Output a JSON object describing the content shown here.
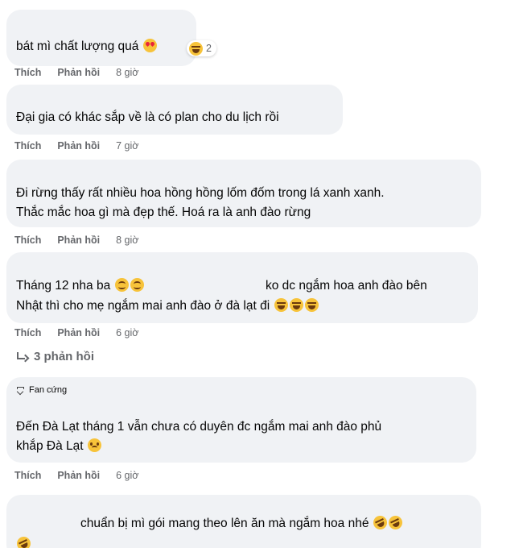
{
  "comments": [
    {
      "lines": [
        "bát mì chất lượng quá"
      ],
      "emojis": [
        "heart-eyes"
      ],
      "reaction_count": "2",
      "like_label": "Thích",
      "reply_label": "Phản hồi",
      "time": "8 giờ"
    },
    {
      "lines": [
        "Đại gia có khác sắp về là có plan cho du lịch rồi"
      ],
      "like_label": "Thích",
      "reply_label": "Phản hồi",
      "time": "7 giờ"
    },
    {
      "lines": [
        "Đi rừng thấy rất nhiều hoa hồng hồng lốm đốm trong lá xanh xanh.",
        "Thắc mắc hoa gì mà đẹp thế. Hoá ra là anh đào rừng"
      ],
      "like_label": "Thích",
      "reply_label": "Phản hồi",
      "time": "8 giờ"
    },
    {
      "lines": [
        "Tháng 12 nha ba",
        "ko dc ngắm hoa anh đào bên",
        "Nhật thì cho mẹ ngắm mai anh đào ở đà lạt đi"
      ],
      "like_label": "Thích",
      "reply_label": "Phản hồi",
      "time": "6 giờ",
      "replies_link": "3 phản hồi"
    },
    {
      "badge": "Fan cứng",
      "lines": [
        "Đến Đà Lạt tháng 1 vẫn chưa có duyên đc ngắm mai anh đào phủ",
        "khắp Đà Lạt"
      ],
      "like_label": "Thích",
      "reply_label": "Phản hồi",
      "time": "6 giờ"
    },
    {
      "lines": [
        "chuẩn bị mì gói mang theo lên ăn mà ngắm hoa nhé"
      ]
    }
  ]
}
